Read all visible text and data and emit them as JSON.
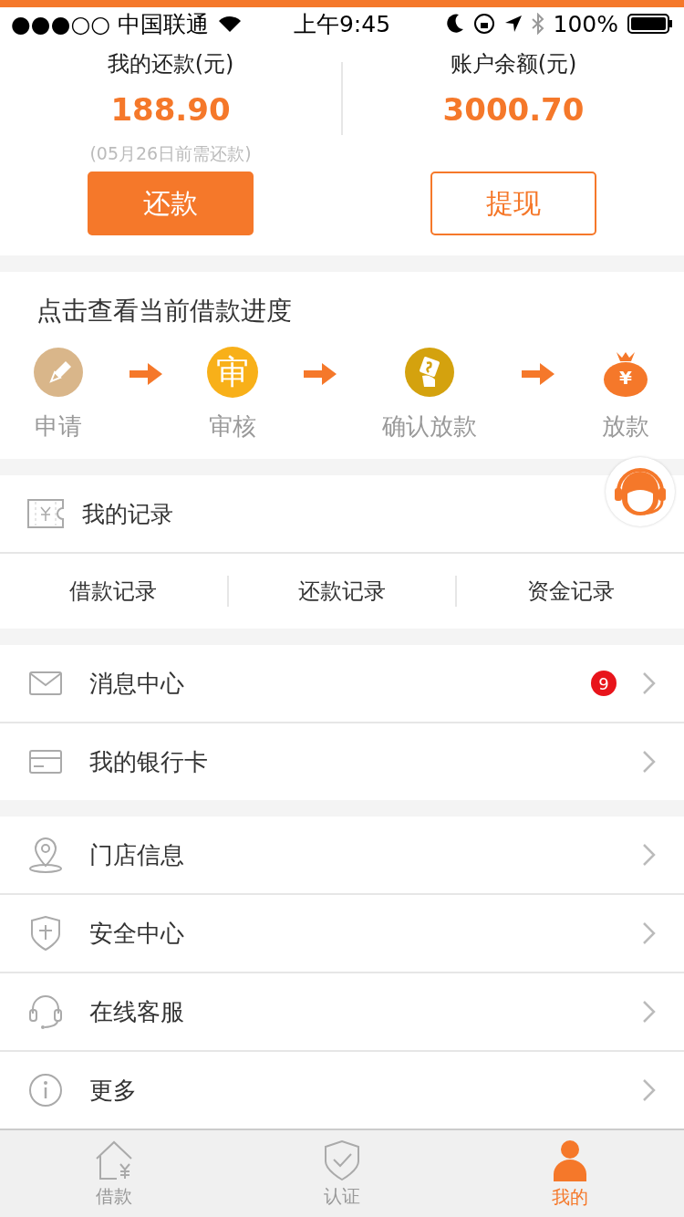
{
  "status_bar": {
    "carrier": "●●●○○ 中国联通",
    "time": "上午9:45",
    "battery": "100%"
  },
  "summary": [
    {
      "label": "我的还款(元)",
      "amount": "188.90",
      "note": "(05月26日前需还款)",
      "button": "还款",
      "primary": true
    },
    {
      "label": "账户余额(元)",
      "amount": "3000.70",
      "button": "提现",
      "primary": false
    }
  ],
  "progress": {
    "title": "点击查看当前借款进度",
    "steps": [
      {
        "label": "申请"
      },
      {
        "label": "审核",
        "icon_text": "审"
      },
      {
        "label": "确认放款"
      },
      {
        "label": "放款",
        "icon_text": "¥"
      }
    ]
  },
  "records": {
    "title": "我的记录",
    "tabs": [
      "借款记录",
      "还款记录",
      "资金记录"
    ]
  },
  "menu_groups": [
    [
      {
        "label": "消息中心",
        "badge": "9"
      },
      {
        "label": "我的银行卡"
      }
    ],
    [
      {
        "label": "门店信息"
      },
      {
        "label": "安全中心"
      },
      {
        "label": "在线客服"
      },
      {
        "label": "更多"
      }
    ]
  ],
  "tab_bar": [
    {
      "label": "借款",
      "selected": false
    },
    {
      "label": "认证",
      "selected": false
    },
    {
      "label": "我的",
      "selected": true
    }
  ]
}
